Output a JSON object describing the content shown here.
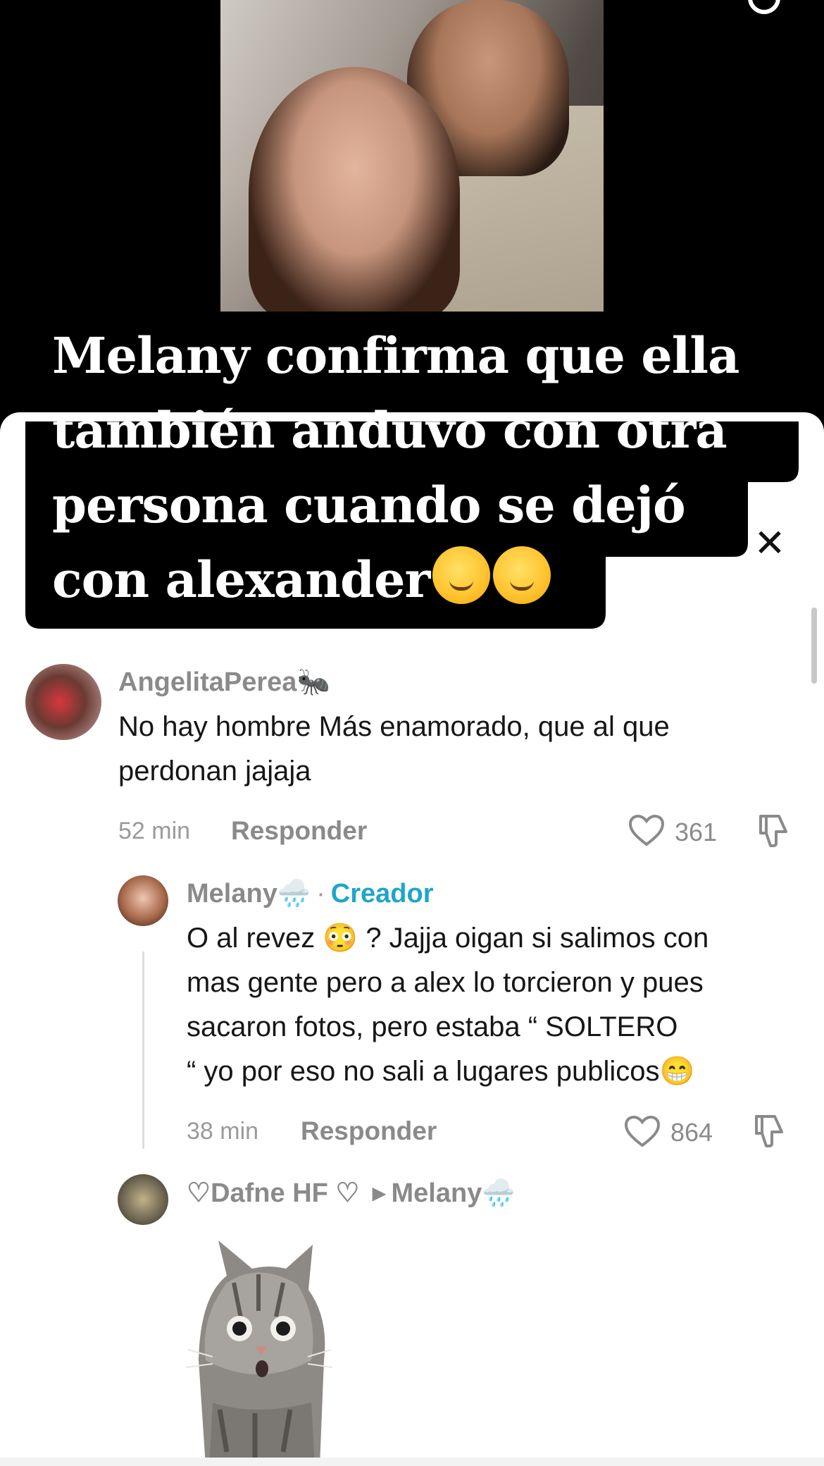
{
  "video": {
    "caption_lines": [
      "Melany confirma que ella",
      "también anduvo con otra",
      "persona cuando se dejó",
      "con alexander"
    ],
    "caption_emojis": [
      "upside-down-face-emoji",
      "relieved-face-emoji"
    ]
  },
  "comments": [
    {
      "username": "AngelitaPerea🐜",
      "text_lines": [
        "No hay hombre Más enamorado, que al que",
        "perdonan jajaja"
      ],
      "time": "52 min",
      "reply_label": "Responder",
      "likes": "361"
    },
    {
      "username": "Melany🌧️",
      "badge": "Creador",
      "text_lines": [
        "O al revez 😳 ? Jajja oigan si salimos con",
        "mas gente pero a alex lo torcieron y pues",
        "sacaron fotos, pero estaba “ SOLTERO",
        "“ yo por eso no sali a lugares publicos😁"
      ],
      "time": "38 min",
      "reply_label": "Responder",
      "likes": "864"
    },
    {
      "username": "♡Dafne HF ♡",
      "reply_to": "Melany🌧️",
      "sticker": "shocked-cat-sticker"
    }
  ]
}
